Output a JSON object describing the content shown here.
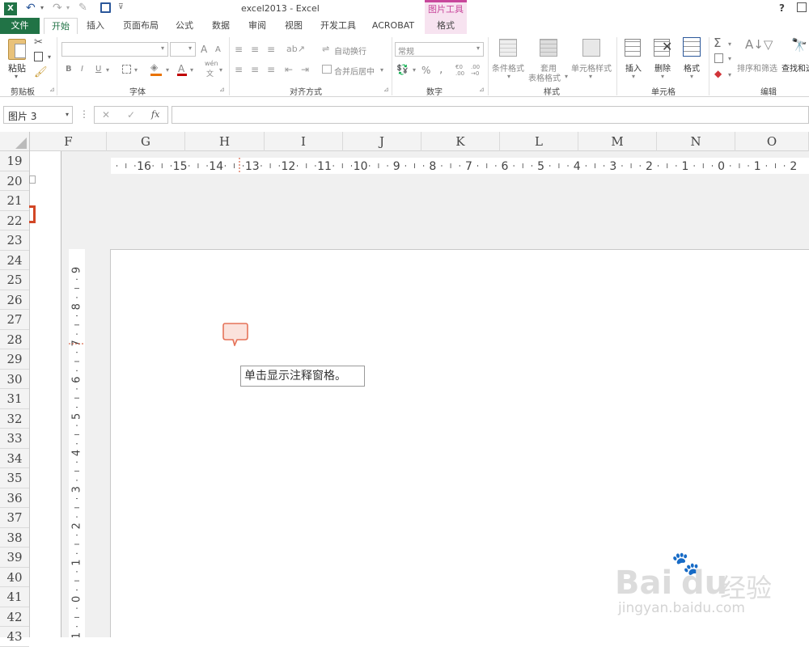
{
  "window": {
    "title": "excel2013 - Excel",
    "help": "?"
  },
  "context_tab_group": "图片工具",
  "tabs": [
    {
      "label": "文件",
      "active": false,
      "file": true
    },
    {
      "label": "开始",
      "active": true
    },
    {
      "label": "插入"
    },
    {
      "label": "页面布局"
    },
    {
      "label": "公式"
    },
    {
      "label": "数据"
    },
    {
      "label": "审阅"
    },
    {
      "label": "视图"
    },
    {
      "label": "开发工具"
    },
    {
      "label": "ACROBAT"
    },
    {
      "label": "格式",
      "contextual": true
    }
  ],
  "ribbon": {
    "clipboard": {
      "paste": "粘贴",
      "group": "剪贴板"
    },
    "font": {
      "group": "字体",
      "bold": "B",
      "italic": "I",
      "underline": "U",
      "grow": "A",
      "shrink": "A",
      "wen": "wén",
      "wen2": "文"
    },
    "alignment": {
      "group": "对齐方式",
      "wrap": "自动换行",
      "merge": "合并后居中"
    },
    "number": {
      "group": "数字",
      "format": "常规",
      "percent": "%",
      "comma": ",",
      "inc": "€0 .00",
      "dec": ".00 →0"
    },
    "styles": {
      "group": "样式",
      "cond": "条件格式",
      "table": "套用",
      "table2": "表格格式",
      "cell": "单元格样式"
    },
    "cells": {
      "group": "单元格",
      "insert": "插入",
      "delete": "删除",
      "format": "格式"
    },
    "editing": {
      "group": "编辑",
      "sort": "排序和筛选",
      "find": "查找和选"
    }
  },
  "formula_bar": {
    "name_box": "图片 3",
    "cancel": "✕",
    "enter": "✓",
    "fx": "fx",
    "value": ""
  },
  "columns": [
    "F",
    "G",
    "H",
    "I",
    "J",
    "K",
    "L",
    "M",
    "N",
    "O"
  ],
  "rows": [
    "19",
    "20",
    "21",
    "22",
    "23",
    "24",
    "25",
    "26",
    "27",
    "28",
    "29",
    "30",
    "31",
    "32",
    "33",
    "34",
    "35",
    "36",
    "37",
    "38",
    "39",
    "40",
    "41",
    "42",
    "43"
  ],
  "hruler_labels": [
    "16",
    "15",
    "14",
    "13",
    "12",
    "11",
    "10",
    "9",
    "8",
    "7",
    "6",
    "5",
    "4",
    "3",
    "2",
    "1",
    "0",
    "1",
    "2"
  ],
  "vruler_labels": [
    "9",
    "8",
    "7",
    "6",
    "5",
    "4",
    "3",
    "2",
    "1",
    "0",
    "1"
  ],
  "tooltip": "单击显示注释窗格。",
  "watermark": {
    "brand": "Bai",
    "brand2": "du",
    "cn": "经验",
    "url": "jingyan.baidu.com"
  },
  "colors": {
    "excel_green": "#217346",
    "context_pink": "#c8479b",
    "context_bg": "#f7e3f0"
  }
}
